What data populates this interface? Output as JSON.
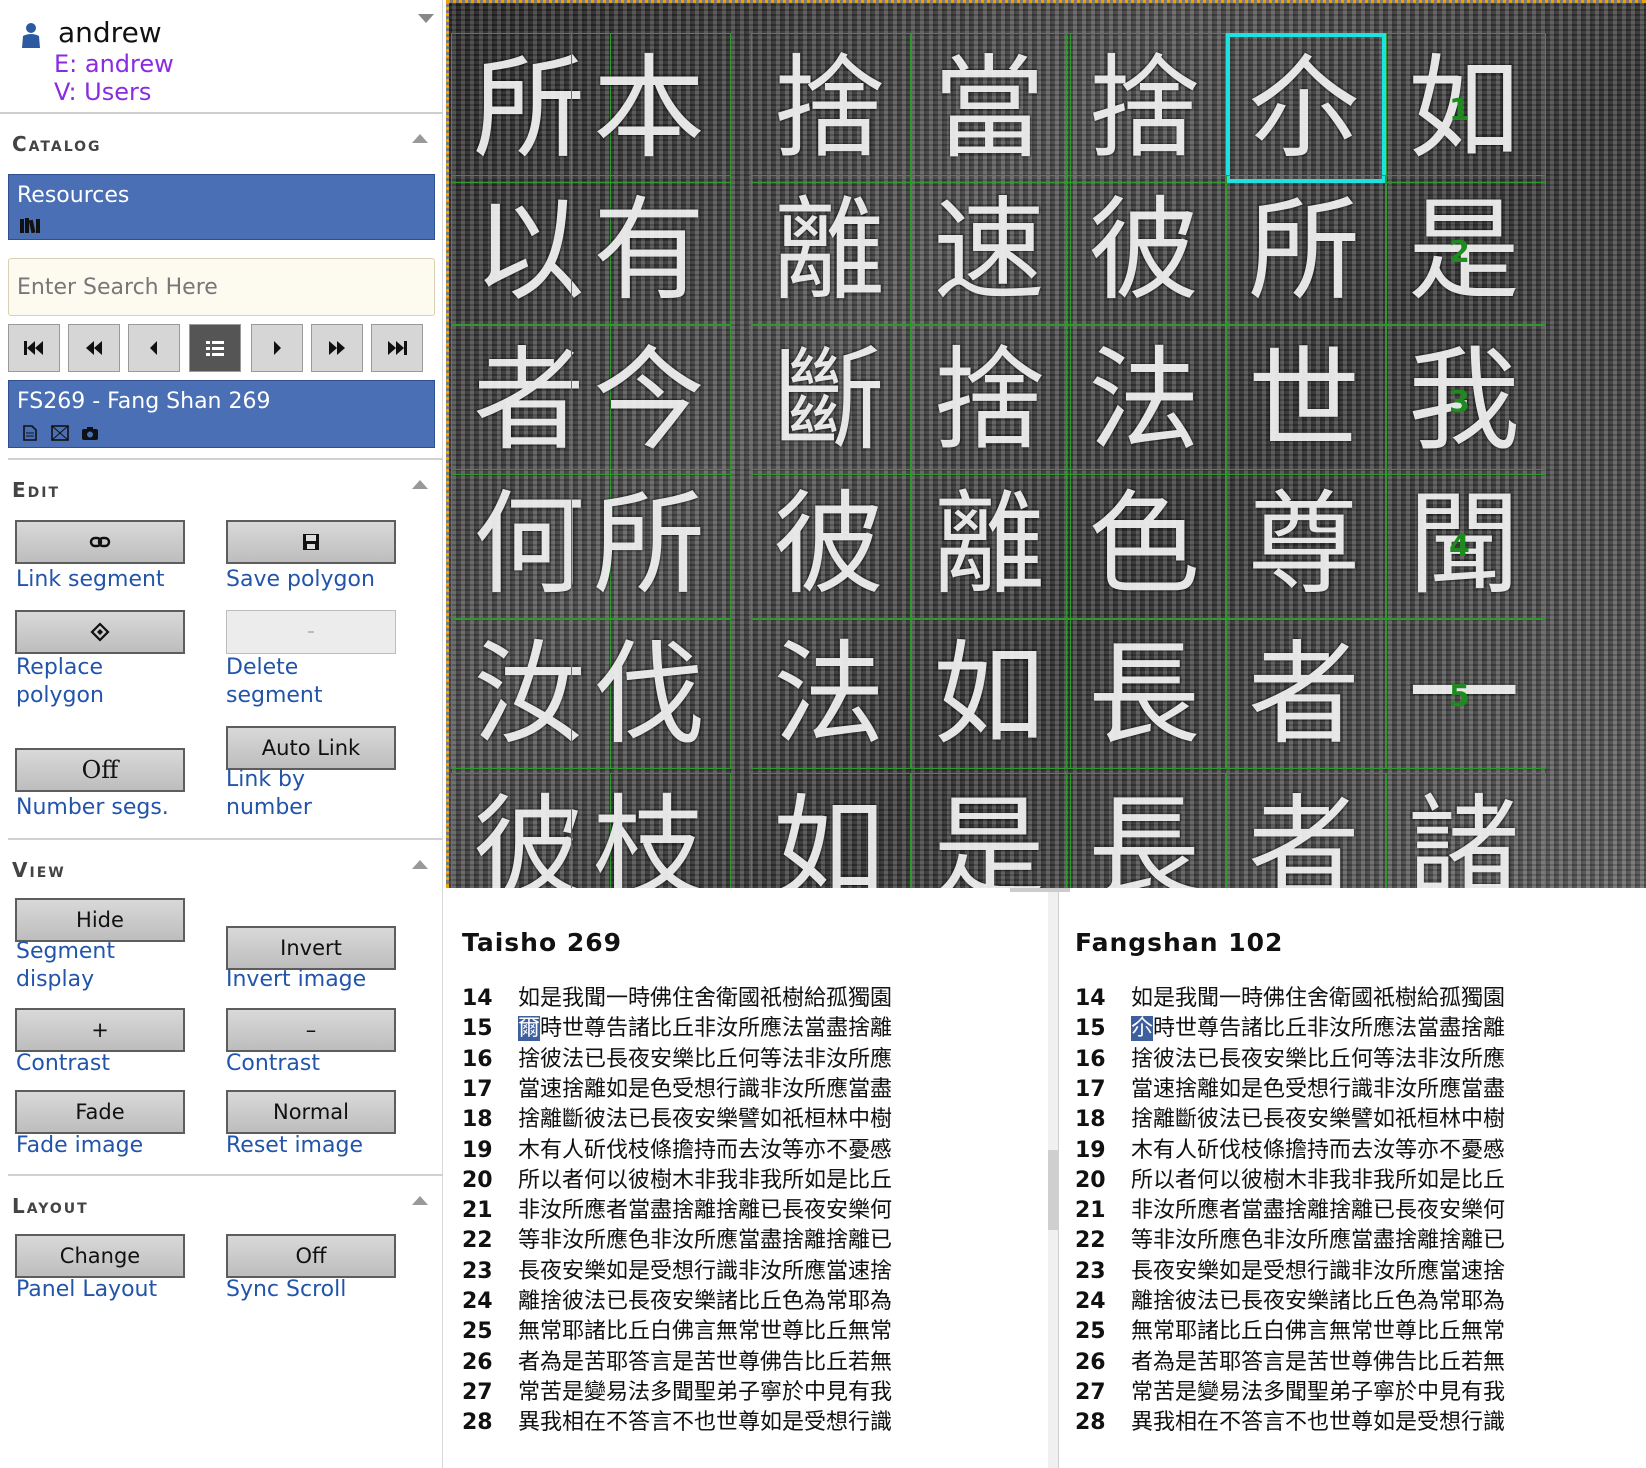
{
  "user": {
    "name": "andrew",
    "e_line": "E: andrew",
    "v_line": "V: Users"
  },
  "sections": {
    "catalog": "Catalog",
    "edit": "Edit",
    "view": "View",
    "layout": "Layout"
  },
  "catalog": {
    "resources_title": "Resources",
    "search_placeholder": "Enter Search Here",
    "resource_item": "FS269 - Fang Shan 269"
  },
  "edit": {
    "link_segment": "Link segment",
    "save_polygon": "Save polygon",
    "replace_polygon": [
      "Replace",
      "polygon"
    ],
    "delete_segment": [
      "Delete",
      "segment"
    ],
    "disabled_glyph": "–",
    "autolink_btn": "Auto Link",
    "link_by_number": [
      "Link by",
      "number"
    ],
    "off_btn": "Off",
    "number_segs": "Number segs."
  },
  "view": {
    "hide_btn": "Hide",
    "segment_display": [
      "Segment",
      "display"
    ],
    "invert_btn": "Invert",
    "invert_image": "Invert image",
    "plus_btn": "+",
    "minus_btn": "–",
    "contrast_label": "Contrast",
    "fade_btn": "Fade",
    "fade_image": "Fade image",
    "normal_btn": "Normal",
    "reset_image": "Reset image"
  },
  "layout": {
    "change_btn": "Change",
    "panel_layout": "Panel Layout",
    "off_btn": "Off",
    "sync_scroll": "Sync Scroll"
  },
  "viewer": {
    "glyph_rows": [
      "所本捨當捨尒如",
      "以有離速彼所是",
      "者今斷捨法世我",
      "何所彼離色尊聞",
      "汝伐法如長者一",
      "彼枝如是長者諸"
    ],
    "seg_numbers": [
      "1",
      "2",
      "3",
      "4",
      "5"
    ]
  },
  "texts": {
    "left_title": "Taisho 269",
    "right_title": "Fangshan 102",
    "line_numbers": [
      "14",
      "15",
      "16",
      "17",
      "18",
      "19",
      "20",
      "21",
      "22",
      "23",
      "24",
      "25",
      "26",
      "27",
      "28"
    ],
    "left_first_char": "爾",
    "right_first_char": "尒",
    "lines": [
      "如是我聞一時佛住舍衛國祇樹給孤獨園",
      "時世尊告諸比丘非汝所應法當盡捨離",
      "捨彼法已長夜安樂比丘何等法非汝所應",
      "當速捨離如是色受想行識非汝所應當盡",
      "捨離斷彼法已長夜安樂譬如祇桓林中樹",
      "木有人斫伐枝條擔持而去汝等亦不憂慼",
      "所以者何以彼樹木非我非我所如是比丘",
      "非汝所應者當盡捨離捨離已長夜安樂何",
      "等非汝所應色非汝所應當盡捨離捨離已",
      "長夜安樂如是受想行識非汝所應當速捨",
      "離捨彼法已長夜安樂諸比丘色為常耶為",
      "無常耶諸比丘白佛言無常世尊比丘無常",
      "者為是苦耶答言是苦世尊佛告比丘若無",
      "常苦是變易法多聞聖弟子寧於中見有我",
      "異我相在不答言不也世尊如是受想行識"
    ]
  },
  "colors": {
    "accent": "#4a6fb5",
    "link": "#2255aa",
    "identity": "#8a2be2",
    "segment": "#2e9a2e",
    "selected": "#20e0e0"
  }
}
